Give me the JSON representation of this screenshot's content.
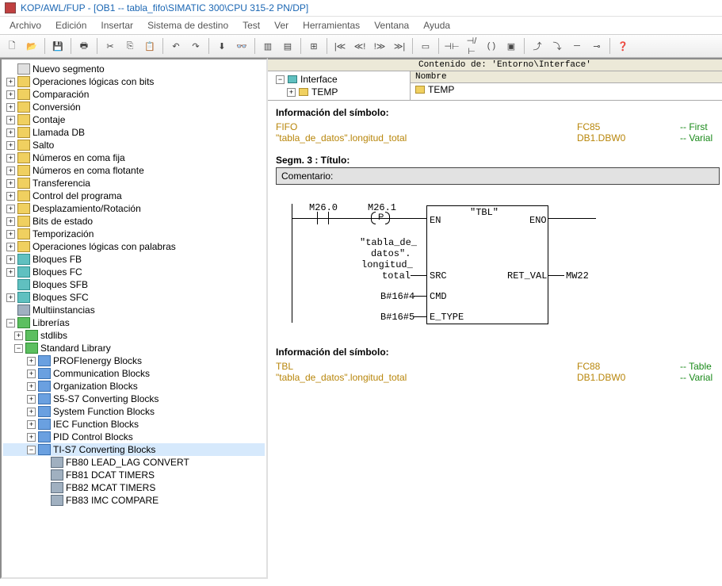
{
  "window": {
    "title": "KOP/AWL/FUP  - [OB1 -- tabla_fifo\\SIMATIC 300\\CPU 315-2 PN/DP]"
  },
  "menu": {
    "archivo": "Archivo",
    "edicion": "Edición",
    "insertar": "Insertar",
    "sistema": "Sistema de destino",
    "test": "Test",
    "ver": "Ver",
    "herramientas": "Herramientas",
    "ventana": "Ventana",
    "ayuda": "Ayuda"
  },
  "tree": {
    "nuevo_segmento": "Nuevo segmento",
    "op_log_bits": "Operaciones lógicas con bits",
    "comparacion": "Comparación",
    "conversion": "Conversión",
    "contaje": "Contaje",
    "llamada_db": "Llamada DB",
    "salto": "Salto",
    "coma_fija": "Números en coma fija",
    "coma_flotante": "Números en coma flotante",
    "transferencia": "Transferencia",
    "ctrl_programa": "Control del programa",
    "desplazamiento": "Desplazamiento/Rotación",
    "bits_estado": "Bits de estado",
    "temporizacion": "Temporización",
    "op_log_palabras": "Operaciones lógicas con palabras",
    "bloques_fb": "Bloques FB",
    "bloques_fc": "Bloques FC",
    "bloques_sfb": "Bloques SFB",
    "bloques_sfc": "Bloques SFC",
    "multiinstancias": "Multiinstancias",
    "librerias": "Librerías",
    "stdlibs": "stdlibs",
    "standard_library": "Standard Library",
    "profienergy": "PROFIenergy Blocks",
    "comm_blocks": "Communication Blocks",
    "org_blocks": "Organization Blocks",
    "s5s7": "S5-S7 Converting Blocks",
    "sysfn": "System Function Blocks",
    "iec": "IEC Function Blocks",
    "pid": "PID Control Blocks",
    "tis7": "TI-S7 Converting Blocks",
    "fb80": "FB80   LEAD_LAG   CONVERT",
    "fb81": "FB81   DCAT   TIMERS",
    "fb82": "FB82   MCAT   TIMERS",
    "fb83": "FB83   IMC   COMPARE"
  },
  "iface": {
    "contenido_hdr": "Contenido de: 'Entorno\\Interface'",
    "interface": "Interface",
    "temp": "TEMP",
    "nombre": "Nombre"
  },
  "sym1": {
    "title": "Información del símbolo:",
    "r1_name": "FIFO",
    "r1_addr": "FC85",
    "r1_cmt": "-- First",
    "r2_name": "\"tabla_de_datos\".longitud_total",
    "r2_addr": "DB1.DBW0",
    "r2_cmt": "-- Varial"
  },
  "seg": {
    "title": "Segm. 3 : Título:",
    "comment_label": "Comentario:",
    "m260": "M26.0",
    "m261": "M26.1",
    "p": "P",
    "tabla": "\"tabla_de_",
    "datos": "datos\".",
    "longitud": "longitud_",
    "total": "total",
    "b164": "B#16#4",
    "b165": "B#16#5",
    "blk_name": "\"TBL\"",
    "en": "EN",
    "eno": "ENO",
    "src": "SRC",
    "retval": "RET_VAL",
    "mw22": "MW22",
    "cmd": "CMD",
    "etype": "E_TYPE"
  },
  "sym2": {
    "title": "Información del símbolo:",
    "r1_name": "TBL",
    "r1_addr": "FC88",
    "r1_cmt": "-- Table",
    "r2_name": "\"tabla_de_datos\".longitud_total",
    "r2_addr": "DB1.DBW0",
    "r2_cmt": "-- Varial"
  }
}
